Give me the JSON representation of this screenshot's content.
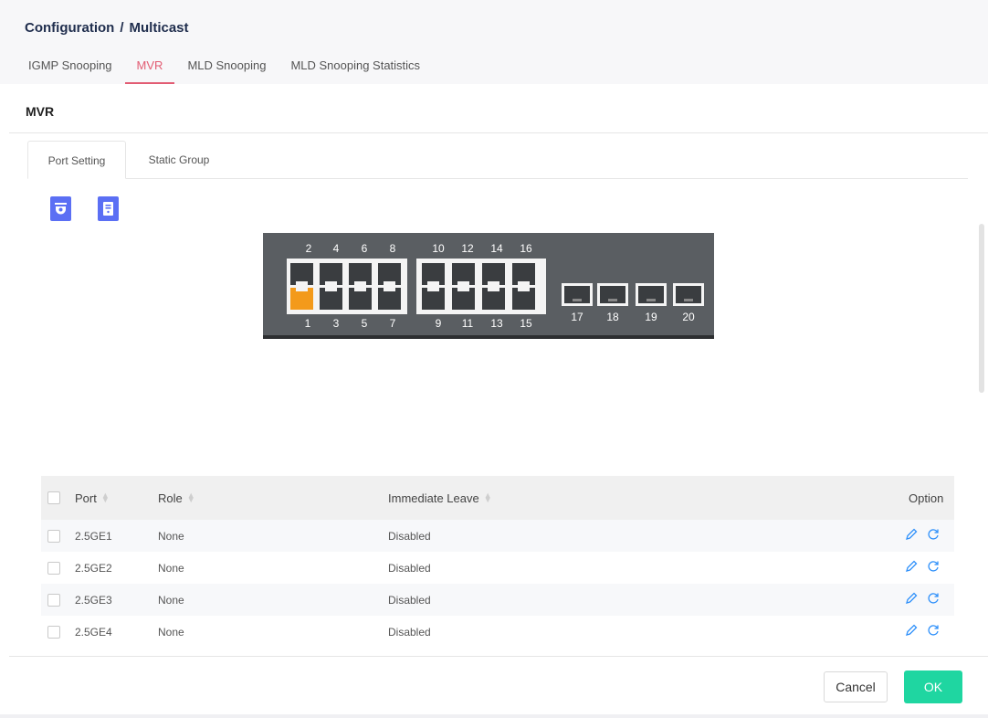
{
  "breadcrumb": {
    "section": "Configuration",
    "separator": "/",
    "page": "Multicast"
  },
  "tabs": [
    {
      "label": "IGMP Snooping",
      "active": false
    },
    {
      "label": "MVR",
      "active": true
    },
    {
      "label": "MLD Snooping",
      "active": false
    },
    {
      "label": "MLD Snooping Statistics",
      "active": false
    }
  ],
  "panel": {
    "title": "MVR"
  },
  "subtabs": [
    {
      "label": "Port Setting",
      "active": true
    },
    {
      "label": "Static Group",
      "active": false
    }
  ],
  "toolbar": {
    "icons": [
      "camera-icon",
      "server-icon"
    ]
  },
  "switch_panel": {
    "top_labels_group1": [
      "2",
      "4",
      "6",
      "8"
    ],
    "top_labels_group2": [
      "10",
      "12",
      "14",
      "16"
    ],
    "bottom_labels_group1": [
      "1",
      "3",
      "5",
      "7"
    ],
    "bottom_labels_group2": [
      "9",
      "11",
      "13",
      "15"
    ],
    "sfp_labels": [
      "17",
      "18",
      "19",
      "20"
    ],
    "active_port": "1"
  },
  "table": {
    "headers": {
      "port": "Port",
      "role": "Role",
      "immediate_leave": "Immediate Leave",
      "option": "Option"
    },
    "rows": [
      {
        "port": "2.5GE1",
        "role": "None",
        "immediate_leave": "Disabled"
      },
      {
        "port": "2.5GE2",
        "role": "None",
        "immediate_leave": "Disabled"
      },
      {
        "port": "2.5GE3",
        "role": "None",
        "immediate_leave": "Disabled"
      },
      {
        "port": "2.5GE4",
        "role": "None",
        "immediate_leave": "Disabled"
      }
    ]
  },
  "footer": {
    "cancel_label": "Cancel",
    "ok_label": "OK"
  },
  "colors": {
    "accent": "#e25c73",
    "icon_button": "#5b6ff4",
    "ok_button": "#1fd6a1",
    "active_port": "#f39a1b",
    "option_icon": "#2e90fa"
  }
}
